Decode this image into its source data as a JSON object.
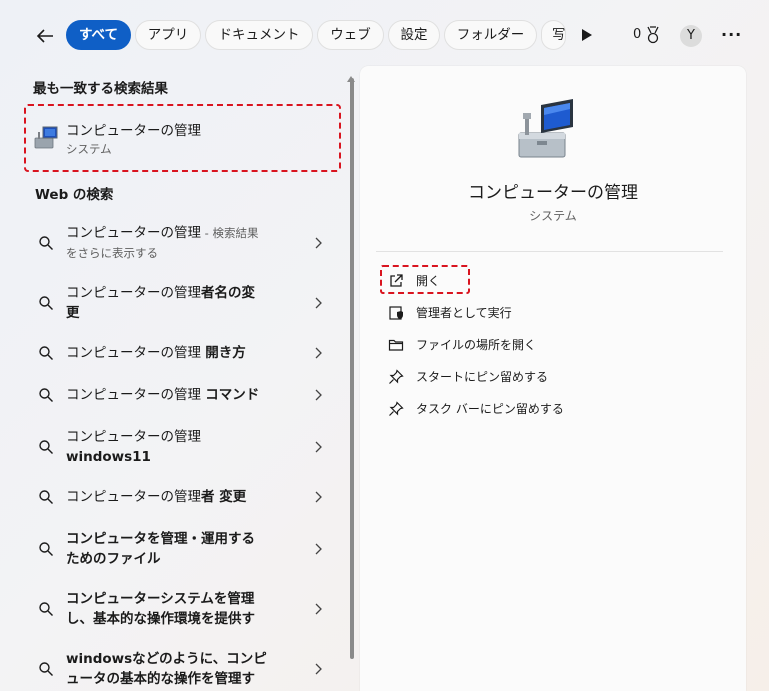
{
  "header": {
    "back_label": "←",
    "filters": [
      "すべて",
      "アプリ",
      "ドキュメント",
      "ウェブ",
      "設定",
      "フォルダー",
      "写"
    ],
    "points": "0",
    "avatar_initial": "Y",
    "more_label": "···",
    "accent_color": "#0f5fc6"
  },
  "best_match": {
    "section_title": "最も一致する検索結果",
    "title": "コンピューターの管理",
    "subtitle": "システム"
  },
  "web_search": {
    "section_title": "Web の検索",
    "rows": [
      {
        "line1_plain": "コンピューターの管理",
        "line1_muted": " - 検索結果",
        "line2_muted": "をさらに表示する"
      },
      {
        "line1_plain": "コンピューターの管理",
        "line1_bold": "者名の変",
        "line2_bold": "更"
      },
      {
        "line1_plain": "コンピューターの管理 ",
        "line1_bold": "開き方"
      },
      {
        "line1_plain": "コンピューターの管理 ",
        "line1_bold": "コマンド"
      },
      {
        "line1_plain": "コンピューターの管理",
        "line2_bold": "windows11"
      },
      {
        "line1_plain": "コンピューターの管理",
        "line1_bold": "者 変更"
      },
      {
        "line1_bold": "コンピュータを管理・運用する",
        "line2_bold": "ためのファイル"
      },
      {
        "line1_bold": "コンピューターシステムを管理",
        "line2_bold": "し、基本的な操作環境を提供す"
      },
      {
        "line1_bold": "windowsなどのように、コンピ",
        "line2_bold": "ュータの基本的な操作を管理す"
      }
    ]
  },
  "detail": {
    "title": "コンピューターの管理",
    "subtitle": "システム",
    "actions": [
      {
        "label": "開く",
        "icon": "open-external-icon"
      },
      {
        "label": "管理者として実行",
        "icon": "shield-admin-icon"
      },
      {
        "label": "ファイルの場所を開く",
        "icon": "folder-icon"
      },
      {
        "label": "スタートにピン留めする",
        "icon": "pin-icon"
      },
      {
        "label": "タスク バーにピン留めする",
        "icon": "pin-icon"
      }
    ]
  }
}
